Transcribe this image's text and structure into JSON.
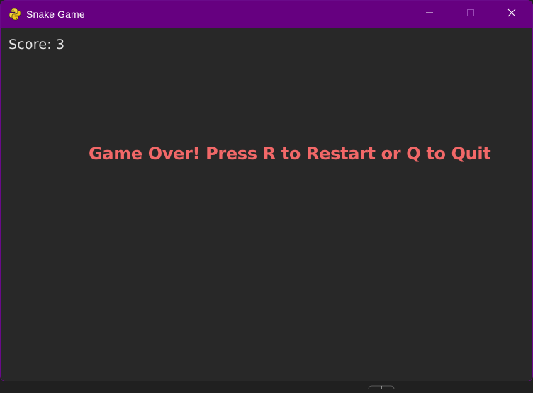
{
  "window": {
    "title": "Snake Game",
    "app_icon": "python-snake-icon",
    "titlebar_color": "#660080",
    "caption_buttons": {
      "minimize_icon": "minimize-icon",
      "maximize_icon": "maximize-icon",
      "close_icon": "close-icon"
    }
  },
  "game": {
    "background_color": "#282828",
    "score_text": "Score: 3",
    "game_over_text": "Game Over! Press R to Restart or Q to Quit",
    "game_over_color": "#f26868"
  }
}
